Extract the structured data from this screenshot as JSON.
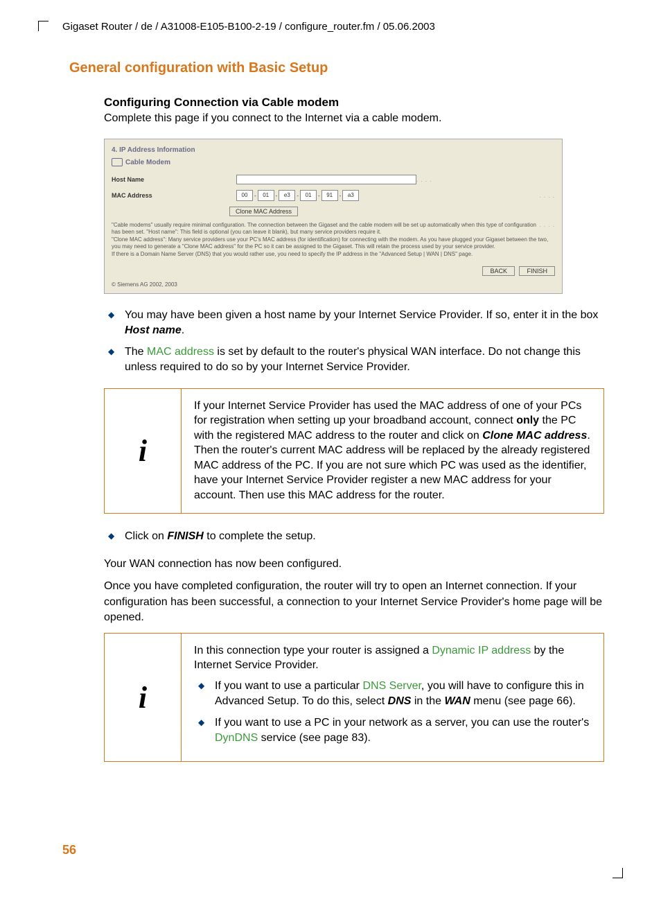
{
  "header": {
    "path": "Gigaset Router / de / A31008-E105-B100-2-19 / configure_router.fm / 05.06.2003"
  },
  "title": "General configuration with Basic Setup",
  "subheading": "Configuring Connection via Cable modem",
  "lead": "Complete this page if you connect to the Internet via a cable modem.",
  "screenshot": {
    "step_title": "4. IP Address Information",
    "conn_type": "Cable Modem",
    "labels": {
      "host": "Host Name",
      "mac": "MAC Address"
    },
    "host_value": "",
    "mac": [
      "00",
      "01",
      "e3",
      "01",
      "91",
      "a3"
    ],
    "clone_btn": "Clone MAC Address",
    "help1": "\"Cable modems\" usually require minimal configuration. The connection between the Gigaset and the cable modem will be set up automatically when this type of configuration has been set. \"Host name\": This field is optional (you can leave it blank), but many service providers require it.",
    "help2": "\"Clone MAC address\": Many service providers use your PC's MAC address (for identification) for connecting with the modem. As you have plugged your Gigaset between the two, you may need to generate a \"Clone MAC address\" for the PC so it can be assigned to the Gigaset. This will retain the process used by your service provider.",
    "help3": "If there is a Domain Name Server (DNS) that you would rather use, you need to specify the IP address in the \"Advanced Setup | WAN | DNS\" page.",
    "back": "BACK",
    "finish": "FINISH",
    "copyright": "© Siemens AG 2002, 2003"
  },
  "bullets1": {
    "b1a": "You may have been given a host name by your Internet Service Provider. If so, enter it in the box ",
    "b1b": "Host name",
    "b1c": ".",
    "b2a": "The ",
    "b2b": "MAC address",
    "b2c": " is set by default to the router's physical WAN interface. Do not change this unless required to do so by your Internet Service Provider."
  },
  "info1": {
    "t1": "If your Internet Service Provider has used the MAC address of one of your PCs for registration when setting up your broadband account, connect ",
    "t2": "only",
    "t3": "  the PC with the registered MAC address to the router and click on ",
    "t4": "Clone MAC address",
    "t5": ". Then the router's current MAC address will be replaced by the already registered MAC address of the PC. If you are not sure which PC was used as the identifier, have your Internet Service Provider register a new MAC address for your account. Then use this MAC address for the router."
  },
  "bullets2": {
    "b1a": "Click on ",
    "b1b": "FINISH",
    "b1c": " to complete the setup."
  },
  "p1": "Your WAN connection has now been configured.",
  "p2": "Once you have completed configuration, the router will try to open an Internet connection. If your configuration has been successful, a connection to your Internet Service Provider's home page will be opened.",
  "info2": {
    "lead1": "In this connection type your router is assigned a ",
    "lead2": "Dynamic IP address",
    "lead3": " by the Internet Service Provider.",
    "b1a": "If you want to use a particular ",
    "b1b": "DNS Server",
    "b1c": ", you will have to configure this in Advanced Setup. To do this, select ",
    "b1d": "DNS",
    "b1e": " in the ",
    "b1f": "WAN",
    "b1g": " menu (see page 66).",
    "b2a": "If you want to use a PC in your network as a server, you can use the router's ",
    "b2b": "DynDNS",
    "b2c": " service (see page 83)."
  },
  "page_number": "56"
}
